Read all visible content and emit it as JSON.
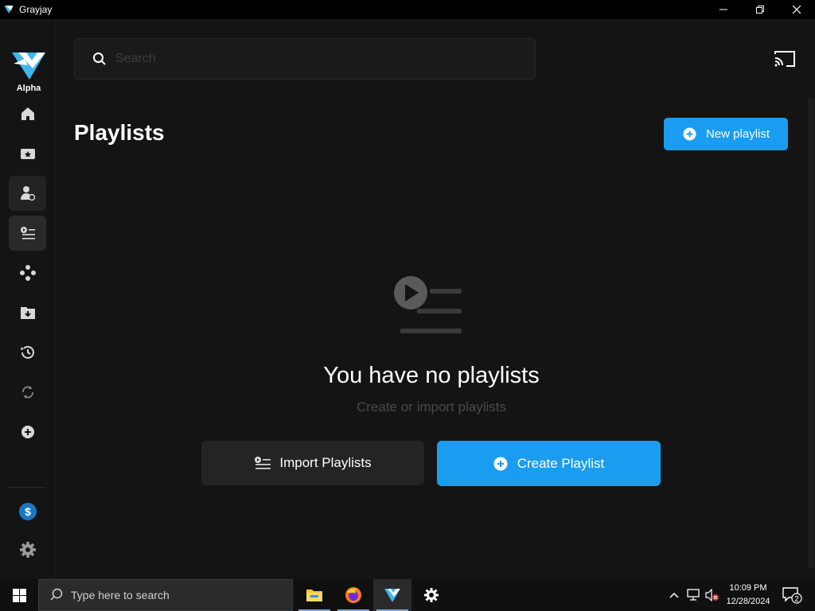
{
  "window": {
    "title": "Grayjay",
    "controls": [
      "minimize",
      "restore",
      "close"
    ]
  },
  "sidebar": {
    "logo_text": "Alpha",
    "items": [
      {
        "icon": "home-icon"
      },
      {
        "icon": "subscriptions-icon"
      },
      {
        "icon": "creators-icon"
      },
      {
        "icon": "playlists-icon",
        "active": true
      },
      {
        "icon": "sources-icon"
      },
      {
        "icon": "downloads-icon"
      },
      {
        "icon": "history-icon"
      },
      {
        "icon": "sync-icon"
      },
      {
        "icon": "add-icon"
      },
      {
        "icon": "donate-icon"
      },
      {
        "icon": "settings-icon"
      }
    ]
  },
  "search": {
    "placeholder": "Search",
    "value": ""
  },
  "main": {
    "title": "Playlists",
    "new_playlist_label": "New playlist",
    "empty_state": {
      "title": "You have no playlists",
      "subtitle": "Create or import playlists",
      "import_label": "Import Playlists",
      "create_label": "Create Playlist"
    }
  },
  "taskbar": {
    "search_placeholder": "Type here to search",
    "apps": [
      "file-explorer-icon",
      "firefox-icon",
      "grayjay-icon",
      "settings-gear-icon"
    ],
    "time": "10:09 PM",
    "date": "12/28/2024",
    "notification_count": "2"
  },
  "colors": {
    "accent": "#1a9df0",
    "background": "#141414",
    "titlebar": "#000000",
    "taskbar": "#101010"
  }
}
